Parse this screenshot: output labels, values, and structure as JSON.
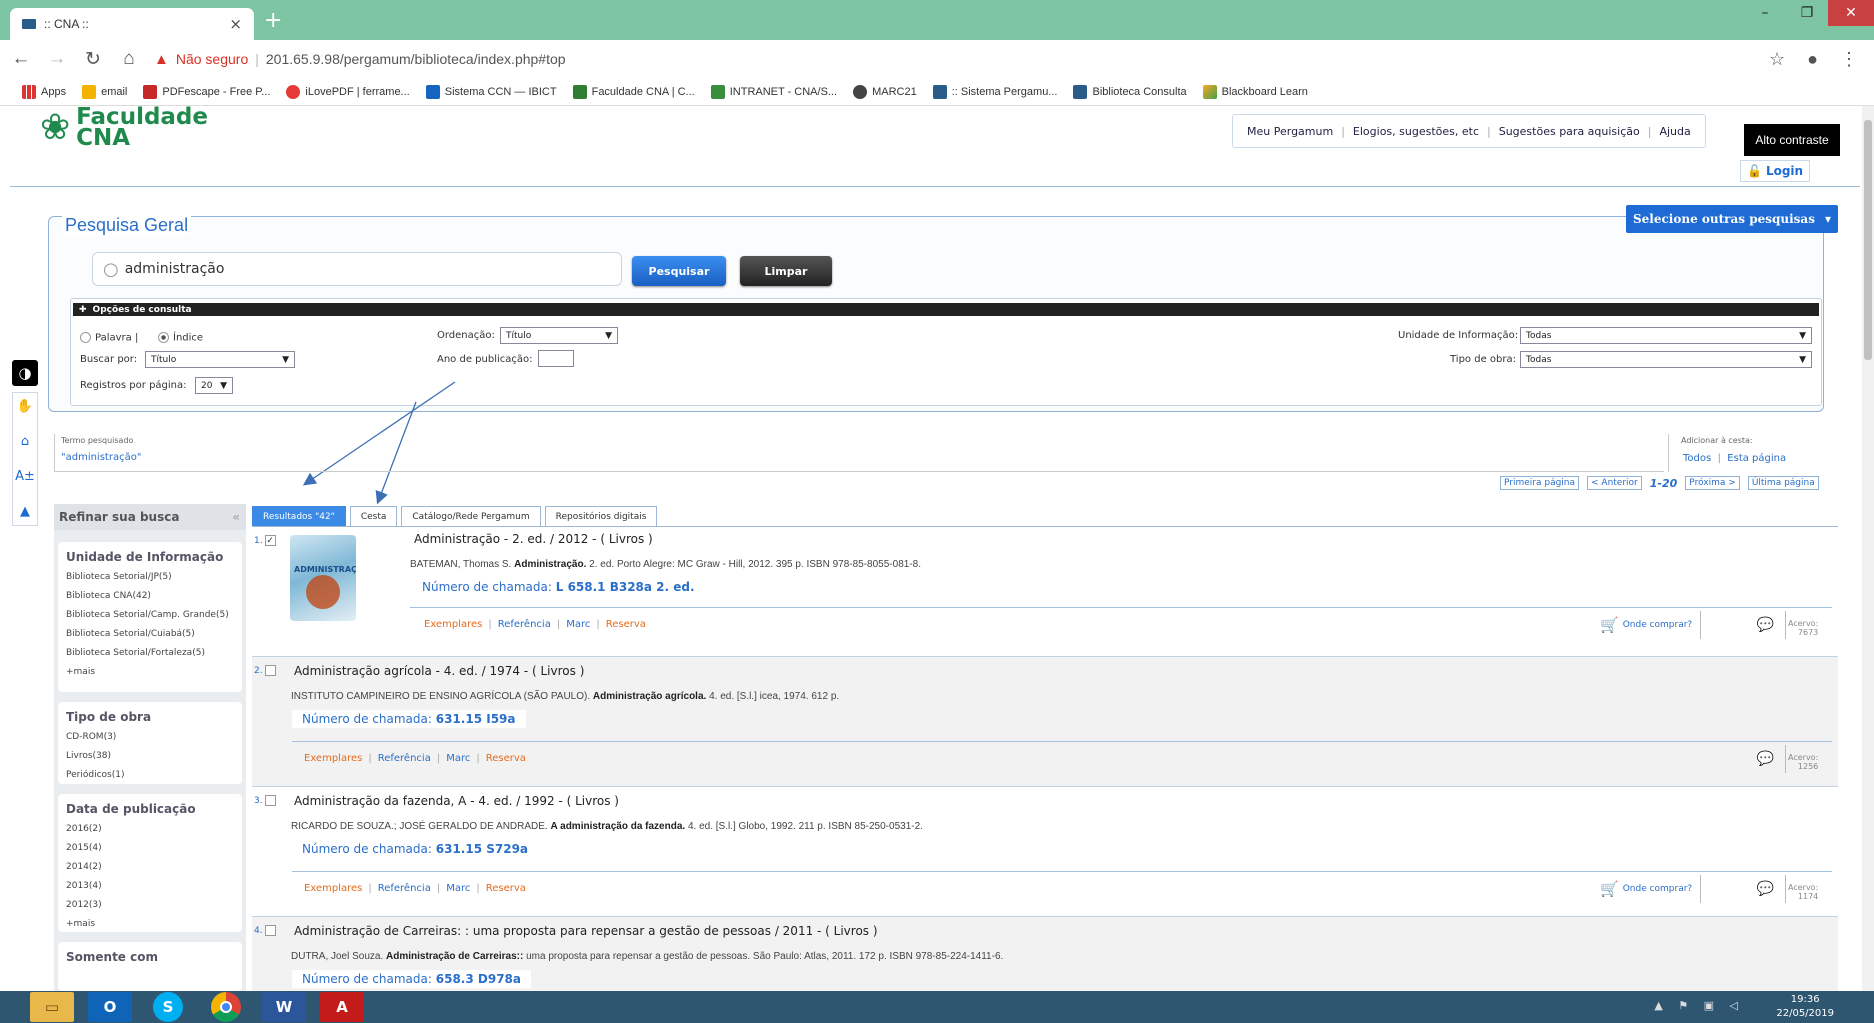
{
  "browser": {
    "tab_title": ":: CNA ::",
    "new_tab": "+",
    "insecure_label": "Não seguro",
    "url": "201.65.9.98/pergamum/biblioteca/index.php#top",
    "bookmarks": [
      "Apps",
      "email",
      "PDFescape - Free P...",
      "iLovePDF | ferrame...",
      "Sistema CCN — IBICT",
      "Faculdade CNA | C...",
      "INTRANET - CNA/S...",
      "MARC21",
      ":: Sistema Pergamu...",
      "Biblioteca Consulta",
      "Blackboard Learn"
    ]
  },
  "header": {
    "logo_line1": "Faculdade",
    "logo_line2": "CNA",
    "menu": [
      "Meu Pergamum",
      "Elogios, sugestões, etc",
      "Sugestões para aquisição",
      "Ajuda"
    ],
    "contrast_button": "Alto contraste",
    "login": "Login"
  },
  "search": {
    "title": "Pesquisa Geral",
    "other_searches": "Selecione outras pesquisas",
    "query": "administração",
    "search_button": "Pesquisar",
    "clear_button": "Limpar",
    "options_title": "Opções de consulta",
    "radio_palavra": "Palavra |",
    "radio_indice": "Índice",
    "ordenacao_label": "Ordenação:",
    "ordenacao_value": "Título",
    "unidade_label": "Unidade de Informação:",
    "unidade_value": "Todas",
    "buscar_por_label": "Buscar por:",
    "buscar_por_value": "Título",
    "ano_label": "Ano de publicação:",
    "tipo_label": "Tipo de obra:",
    "tipo_value": "Todas",
    "registros_label": "Registros por página:",
    "registros_value": "20"
  },
  "term": {
    "label": "Termo pesquisado",
    "value": "\"administração\"",
    "cesta_label": "Adicionar à cesta:",
    "cesta_todos": "Todos",
    "cesta_sep": "|",
    "cesta_pagina": "Esta página"
  },
  "pager": {
    "first": "Primeira página",
    "prev": "< Anterior",
    "range": "1-20",
    "next": "Próxima >",
    "last": "Última página"
  },
  "refine": {
    "title": "Refinar sua busca",
    "facets": [
      {
        "title": "Unidade de Informação",
        "items": [
          "Biblioteca Setorial/JP(5)",
          "Biblioteca CNA(42)",
          "Biblioteca Setorial/Camp. Grande(5)",
          "Biblioteca Setorial/Cuiabá(5)",
          "Biblioteca Setorial/Fortaleza(5)",
          "+mais"
        ]
      },
      {
        "title": "Tipo de obra",
        "items": [
          "CD-ROM(3)",
          "Livros(38)",
          "Periódicos(1)"
        ]
      },
      {
        "title": "Data de publicação",
        "items": [
          "2016(2)",
          "2015(4)",
          "2014(2)",
          "2013(4)",
          "2012(3)",
          "+mais"
        ]
      },
      {
        "title": "Somente com",
        "items": []
      }
    ]
  },
  "tabs": [
    "Resultados \"42\"",
    "Cesta",
    "Catálogo/Rede Pergamum",
    "Repositórios digitais"
  ],
  "results": [
    {
      "num": "1.",
      "checked": "✓",
      "title": "Administração - 2. ed. / 2012 - ( Livros )",
      "ref_author": "BATEMAN, Thomas S.",
      "ref_title": "Administração.",
      "ref_rest": "2. ed. Porto Alegre: MC Graw - Hill, 2012. 395 p. ISBN 978-85-8055-081-8.",
      "call_label": "Número de chamada:",
      "call_value": "L 658.1 B328a 2. ed.",
      "cover_text": "ADMINISTRAÇÃO",
      "buy": "Onde comprar?",
      "acervo_label": "Acervo:",
      "acervo": "7673"
    },
    {
      "num": "2.",
      "checked": "",
      "title": "Administração agrícola - 4. ed. / 1974 - ( Livros )",
      "ref_author": "INSTITUTO CAMPINEIRO DE ENSINO AGRÍCOLA (SÃO PAULO).",
      "ref_title": "Administração agrícola.",
      "ref_rest": "4. ed. [S.l.] icea, 1974. 612 p.",
      "call_label": "Número de chamada:",
      "call_value": "631.15 I59a",
      "acervo_label": "Acervo:",
      "acervo": "1256"
    },
    {
      "num": "3.",
      "checked": "",
      "title": "Administração da fazenda, A - 4. ed. / 1992 - ( Livros )",
      "ref_author": "RICARDO DE SOUZA.; JOSÉ GERALDO DE ANDRADE.",
      "ref_title": "A administração da fazenda.",
      "ref_rest": "4. ed. [S.l.] Globo, 1992. 211 p. ISBN 85-250-0531-2.",
      "call_label": "Número de chamada:",
      "call_value": "631.15 S729a",
      "buy": "Onde comprar?",
      "acervo_label": "Acervo:",
      "acervo": "1174"
    },
    {
      "num": "4.",
      "checked": "",
      "title": "Administração de Carreiras: : uma proposta para repensar a gestão de pessoas / 2011 - ( Livros )",
      "ref_author": "DUTRA, Joel Souza.",
      "ref_title": "Administração de Carreiras::",
      "ref_rest": "uma proposta para repensar a gestão de pessoas. São Paulo: Atlas, 2011. 172 p. ISBN 978-85-224-1411-6.",
      "call_label": "Número de chamada:",
      "call_value": "658.3 D978a"
    }
  ],
  "actions": {
    "exemplares": "Exemplares",
    "referencia": "Referência",
    "marc": "Marc",
    "reserva": "Reserva"
  },
  "taskbar": {
    "time": "19:36",
    "date": "22/05/2019"
  },
  "colors": {
    "brand_green": "#1f8a4c",
    "tab_green": "#7dc5a2",
    "link_blue": "#2a6fc9",
    "action_orange": "#e46d1f",
    "taskbar": "#2f5670"
  },
  "icons": [
    "back-icon",
    "forward-icon",
    "reload-icon",
    "home-icon",
    "warning-icon",
    "star-icon",
    "profile-icon",
    "menu-icon",
    "contrast-icon",
    "search-icon",
    "cart-icon",
    "comment-icon"
  ]
}
